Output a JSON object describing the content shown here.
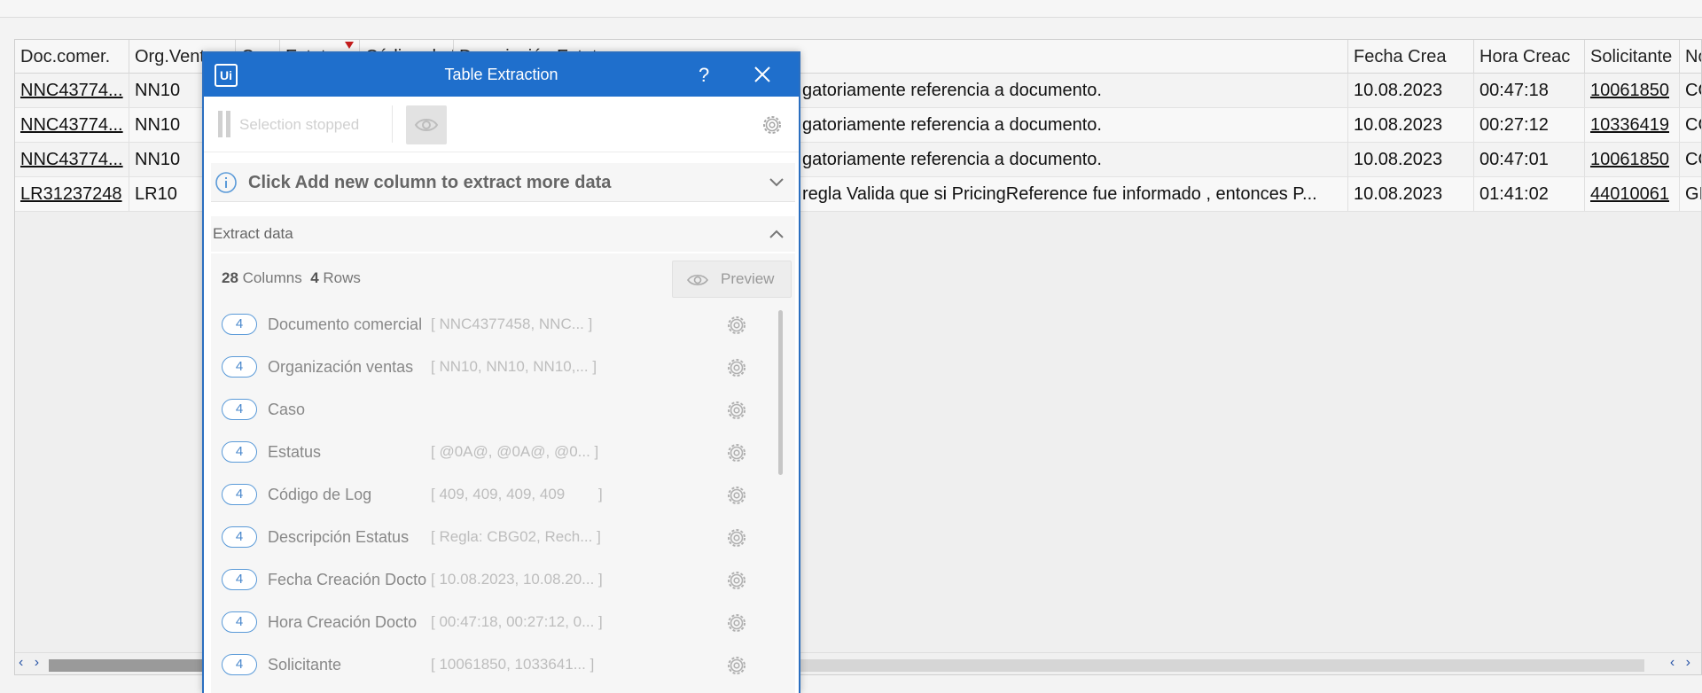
{
  "grid": {
    "headers": [
      "Doc.comer.",
      "Org.Ventas",
      "Caso",
      "Estatus",
      "Código de Log",
      "Descripción Estatus",
      "Fecha Crea",
      "Hora Creac",
      "Solicitante",
      "No"
    ],
    "rows": [
      {
        "doc": "NNC43774...",
        "org": "NN10",
        "desc": "gatoriamente referencia a documento.",
        "fecha": "10.08.2023",
        "hora": "00:47:18",
        "solicitante": "10061850",
        "extra": "CO"
      },
      {
        "doc": "NNC43774...",
        "org": "NN10",
        "desc": "gatoriamente referencia a documento.",
        "fecha": "10.08.2023",
        "hora": "00:27:12",
        "solicitante": "10336419",
        "extra": "CO"
      },
      {
        "doc": "NNC43774...",
        "org": "NN10",
        "desc": "gatoriamente referencia a documento.",
        "fecha": "10.08.2023",
        "hora": "00:47:01",
        "solicitante": "10061850",
        "extra": "CO"
      },
      {
        "doc": "LR31237248",
        "org": "LR10",
        "desc": "regla Valida que si PricingReference fue informado , entonces P...",
        "fecha": "10.08.2023",
        "hora": "01:41:02",
        "solicitante": "44010061",
        "extra": "GI"
      }
    ],
    "scroll_left": "‹ ›",
    "scroll_right": "‹ ›"
  },
  "dialog": {
    "logo": "Ui",
    "title": "Table Extraction",
    "help": "?",
    "toolbar": {
      "status": "Selection stopped"
    },
    "info": "Click Add new column to extract more data",
    "extract_title": "Extract data",
    "counts": {
      "columns": "28",
      "columns_label": "Columns",
      "rows": "4",
      "rows_label": "Rows"
    },
    "preview_label": "Preview",
    "columns": [
      {
        "count": "4",
        "name": "Documento comercial",
        "values": "[ NNC4377458, NNC... ]"
      },
      {
        "count": "4",
        "name": "Organización ventas",
        "values": "[ NN10, NN10, NN10,... ]"
      },
      {
        "count": "4",
        "name": "Caso",
        "values": ""
      },
      {
        "count": "4",
        "name": "Estatus",
        "values": "[ @0A@, @0A@, @0... ]"
      },
      {
        "count": "4",
        "name": "Código de Log",
        "values": "[ 409, 409, 409, 409        ]"
      },
      {
        "count": "4",
        "name": "Descripción Estatus",
        "values": "[ Regla: CBG02, Rech... ]"
      },
      {
        "count": "4",
        "name": "Fecha Creación Docto",
        "values": "[ 10.08.2023, 10.08.20... ]"
      },
      {
        "count": "4",
        "name": "Hora Creación Docto",
        "values": "[ 00:47:18, 00:27:12, 0... ]"
      },
      {
        "count": "4",
        "name": "Solicitante",
        "values": "[ 10061850, 1033641... ]"
      }
    ]
  }
}
